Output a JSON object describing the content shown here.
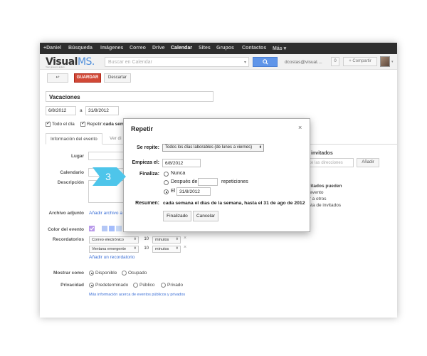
{
  "gbar": {
    "items": [
      "+Daniel",
      "Búsqueda",
      "Imágenes",
      "Correo",
      "Drive",
      "Calendar",
      "Sites",
      "Grupos",
      "Contactos",
      "Más"
    ],
    "more_caret": "▾"
  },
  "header": {
    "logo_main": "Visual",
    "logo_accent": "MS.",
    "logo_tagline": "Your group in action",
    "search_placeholder": "Buscar en Calendar",
    "search_caret": "▾",
    "search_icon": "🔍",
    "account": "dcostas@visual....",
    "count": "0",
    "share": "+ Compartir",
    "avatar_caret": "▾"
  },
  "toolbar": {
    "back": "↩",
    "save": "GUARDAR",
    "discard": "Descartar"
  },
  "event": {
    "title": "Vacaciones",
    "start_date": "6/8/2012",
    "to": "a",
    "end_date": "31/8/2012",
    "all_day": "Todo el día",
    "repeat": "Repetir:",
    "repeat_summary": "cada sem",
    "tab_info": "Información del evento",
    "tab_availability": "Ver di",
    "where_label": "Lugar",
    "calendar_label": "Calendario",
    "description_label": "Descripción",
    "attachment_label": "Archivo adjunto",
    "attachment_link": "Añadir archivo a",
    "color_label": "Color del evento",
    "reminders_label": "Recordatorios",
    "reminders": [
      {
        "type": "Correo electrónico",
        "value": "10",
        "unit": "minutos"
      },
      {
        "type": "Ventana emergente",
        "value": "10",
        "unit": "minutos"
      }
    ],
    "add_reminder": "Añadir un recordatorio",
    "show_as_label": "Mostrar como",
    "available": "Disponible",
    "busy": "Ocupado",
    "privacy_label": "Privacidad",
    "default": "Predeterminado",
    "public": "Público",
    "private": "Privado",
    "privacy_info": "Más información acerca de eventos públicos y privados"
  },
  "colors": {
    "check_color": "#b99aea",
    "swatches": [
      "#b4c7f5",
      "#a4bdfc",
      "#c9daf8",
      "#a3e4f0"
    ]
  },
  "guests": {
    "title": "invitados",
    "input_placeholder": "ce las direcciones",
    "add": "Añadir",
    "can_title": "ivitados pueden",
    "perms": [
      "r evento",
      "ar a otros",
      "lista de invitados"
    ]
  },
  "dialog": {
    "title": "Repetir",
    "close": "×",
    "repeats_label": "Se repite:",
    "repeats_value": "Todos los días laborables (de lunes a viernes)",
    "starts_label": "Empieza el:",
    "starts_value": "6/8/2012",
    "ends_label": "Finaliza:",
    "never": "Nunca",
    "after": "Después de",
    "occurrences": "repeticiones",
    "on": "El",
    "on_value": "31/8/2012",
    "summary_label": "Resumen:",
    "summary_value": "cada semana el días de la semana, hasta el 31 de ago de 2012",
    "done": "Finalizado",
    "cancel": "Cancelar"
  },
  "step_marker": {
    "number": "3",
    "color": "#4ec5ea"
  }
}
